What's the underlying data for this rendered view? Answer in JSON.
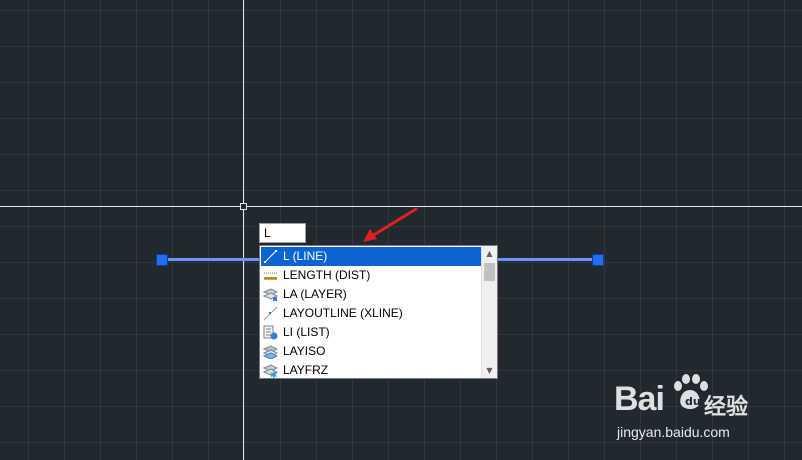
{
  "command_input": {
    "value": "L"
  },
  "suggestions": [
    {
      "label": "L (LINE)",
      "icon": "line-icon",
      "selected": true
    },
    {
      "label": "LENGTH (DIST)",
      "icon": "distance-icon",
      "selected": false
    },
    {
      "label": "LA (LAYER)",
      "icon": "layer-icon",
      "selected": false
    },
    {
      "label": "LAYOUTLINE (XLINE)",
      "icon": "xline-icon",
      "selected": false
    },
    {
      "label": "LI (LIST)",
      "icon": "list-icon",
      "selected": false
    },
    {
      "label": "LAYISO",
      "icon": "layer-isolate-icon",
      "selected": false
    },
    {
      "label": "LAYFRZ",
      "icon": "layer-freeze-icon",
      "selected": false
    }
  ],
  "watermark": {
    "brand": "Bai",
    "brand_suffix": "经验",
    "url": "jingyan.baidu.com"
  },
  "colors": {
    "canvas": "#212830",
    "selection": "#0a64d2",
    "grip": "#1f6ff0",
    "selected_line": "#6a95ff",
    "annotation_arrow": "#e02020"
  }
}
